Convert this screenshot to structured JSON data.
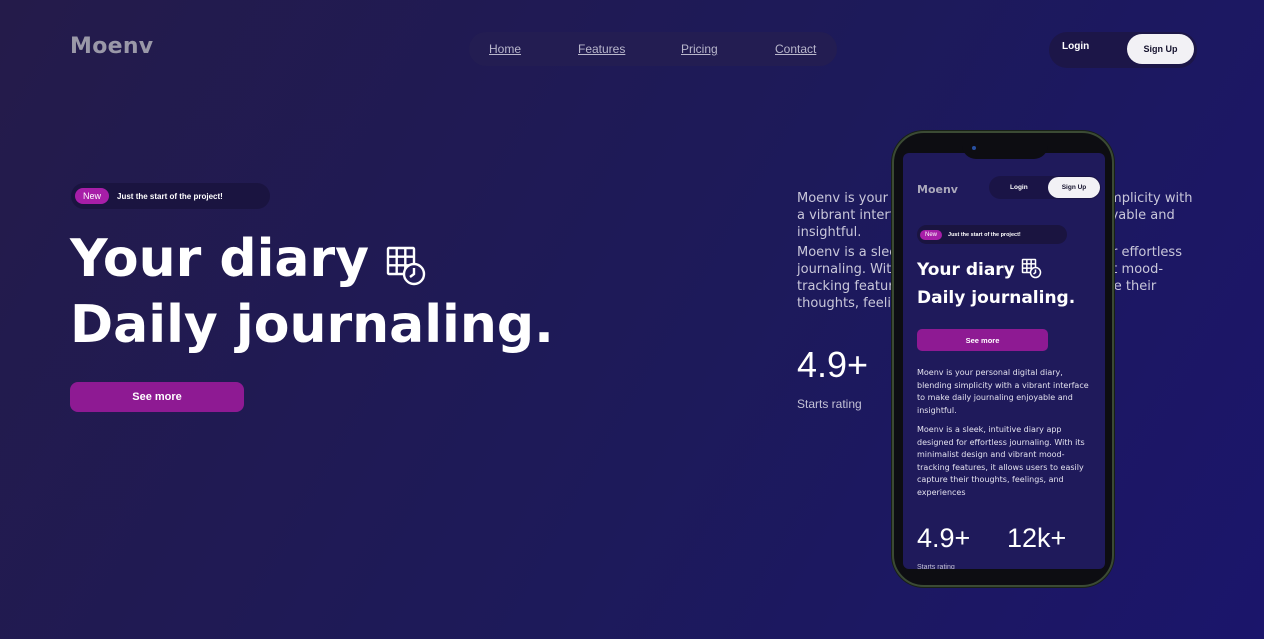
{
  "brand": {
    "name": "Moenv"
  },
  "nav": {
    "links": [
      "Home",
      "Features",
      "Pricing",
      "Contact"
    ]
  },
  "auth": {
    "login_label": "Login",
    "signup_label": "Sign Up"
  },
  "hero": {
    "badge_new": "New",
    "badge_text": "Just the start of the project!",
    "title_line1": "Your diary",
    "title_line2": "Daily journaling.",
    "title_icon": "calendar-clock-icon",
    "cta_label": "See more"
  },
  "about": {
    "paragraph1": "Moenv is your personal digital diary, blending simplicity with a vibrant interface to make daily journaling enjoyable and insightful.",
    "paragraph2": "Moenv is a sleek, intuitive diary app designed for effortless journaling. With its minimalist design and vibrant mood-tracking features, it allows users to easily capture their thoughts, feelings, and experiences"
  },
  "stats": {
    "rating_value": "4.9+",
    "rating_label": "Starts rating",
    "users_value": "12k+"
  },
  "colors": {
    "accent": "#8e1a93",
    "badge": "#a71ea8",
    "background": "#1d1a5a"
  }
}
